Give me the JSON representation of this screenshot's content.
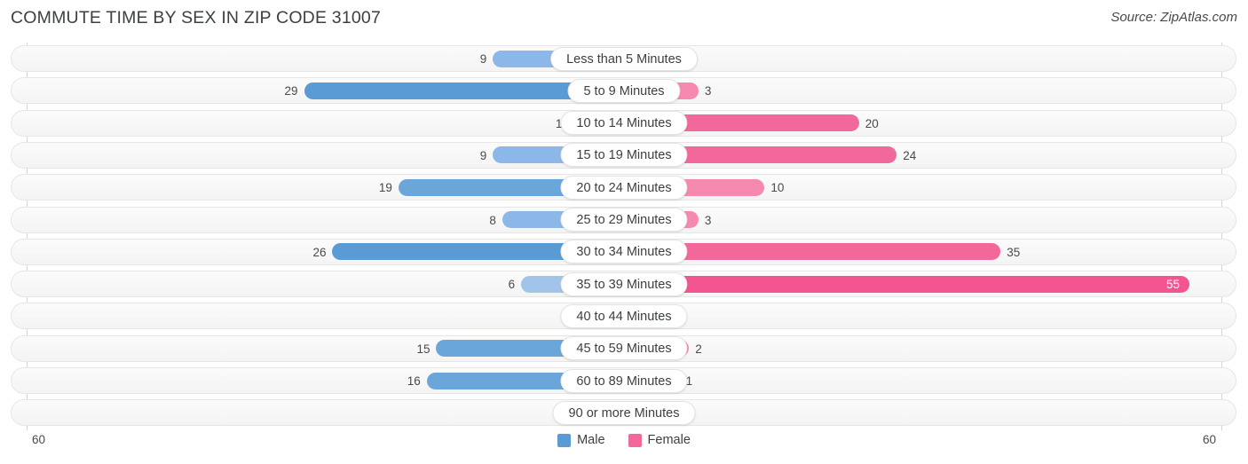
{
  "header": {
    "title": "COMMUTE TIME BY SEX IN ZIP CODE 31007",
    "source": "Source: ZipAtlas.com"
  },
  "axis": {
    "left_tick": "60",
    "right_tick": "60",
    "max": 60
  },
  "legend": {
    "items": [
      {
        "label": "Male",
        "color": "#5b9bd5"
      },
      {
        "label": "Female",
        "color": "#f2689b"
      }
    ]
  },
  "colors": {
    "male_strong": "#5b9bd5",
    "male_light": "#a8c9ec",
    "male_mid": "#8bb8e8",
    "female_strong": "#f2689b",
    "female_light": "#f9a8c4",
    "female_mid": "#f589b0",
    "track": "#f4f4f4",
    "title": "#3c4043"
  },
  "chart_data": {
    "type": "bar",
    "title": "COMMUTE TIME BY SEX IN ZIP CODE 31007",
    "subtitle": "Source: ZipAtlas.com",
    "orientation": "horizontal-diverging",
    "xlabel": "",
    "ylabel": "",
    "xlim": [
      60,
      60
    ],
    "grid": false,
    "legend_position": "bottom-center",
    "categories": [
      "Less than 5 Minutes",
      "5 to 9 Minutes",
      "10 to 14 Minutes",
      "15 to 19 Minutes",
      "20 to 24 Minutes",
      "25 to 29 Minutes",
      "30 to 34 Minutes",
      "35 to 39 Minutes",
      "40 to 44 Minutes",
      "45 to 59 Minutes",
      "60 to 89 Minutes",
      "90 or more Minutes"
    ],
    "series": [
      {
        "name": "Male",
        "values": [
          9,
          29,
          1,
          9,
          19,
          8,
          26,
          6,
          0,
          15,
          16,
          0
        ]
      },
      {
        "name": "Female",
        "values": [
          0,
          3,
          20,
          24,
          10,
          3,
          35,
          55,
          0,
          2,
          1,
          0
        ]
      }
    ]
  },
  "rows": [
    {
      "label": "Less than 5 Minutes",
      "male": "9",
      "female": "0",
      "male_color": "#8bb8e8",
      "female_color": "#f9a8c4",
      "female_inside": false,
      "male_inside": false
    },
    {
      "label": "5 to 9 Minutes",
      "male": "29",
      "female": "3",
      "male_color": "#5b9bd5",
      "female_color": "#f589b0",
      "female_inside": false,
      "male_inside": false
    },
    {
      "label": "10 to 14 Minutes",
      "male": "1",
      "female": "20",
      "male_color": "#a8c9ec",
      "female_color": "#f2689b",
      "female_inside": false,
      "male_inside": false
    },
    {
      "label": "15 to 19 Minutes",
      "male": "9",
      "female": "24",
      "male_color": "#8bb8e8",
      "female_color": "#f2689b",
      "female_inside": false,
      "male_inside": false
    },
    {
      "label": "20 to 24 Minutes",
      "male": "19",
      "female": "10",
      "male_color": "#6ba6db",
      "female_color": "#f589b0",
      "female_inside": false,
      "male_inside": false
    },
    {
      "label": "25 to 29 Minutes",
      "male": "8",
      "female": "3",
      "male_color": "#8bb8e8",
      "female_color": "#f589b0",
      "female_inside": false,
      "male_inside": false
    },
    {
      "label": "30 to 34 Minutes",
      "male": "26",
      "female": "35",
      "male_color": "#5b9bd5",
      "female_color": "#f2689b",
      "female_inside": false,
      "male_inside": false
    },
    {
      "label": "35 to 39 Minutes",
      "male": "6",
      "female": "55",
      "male_color": "#a0c4ea",
      "female_color": "#f2558f",
      "female_inside": true,
      "male_inside": false
    },
    {
      "label": "40 to 44 Minutes",
      "male": "0",
      "female": "0",
      "male_color": "#a8c9ec",
      "female_color": "#f9a8c4",
      "female_inside": false,
      "male_inside": false
    },
    {
      "label": "45 to 59 Minutes",
      "male": "15",
      "female": "2",
      "male_color": "#6ba6db",
      "female_color": "#f589b0",
      "female_inside": false,
      "male_inside": false
    },
    {
      "label": "60 to 89 Minutes",
      "male": "16",
      "female": "1",
      "male_color": "#6ba6db",
      "female_color": "#f589b0",
      "female_inside": false,
      "male_inside": false
    },
    {
      "label": "90 or more Minutes",
      "male": "0",
      "female": "0",
      "male_color": "#a8c9ec",
      "female_color": "#f9a8c4",
      "female_inside": false,
      "male_inside": false
    }
  ]
}
